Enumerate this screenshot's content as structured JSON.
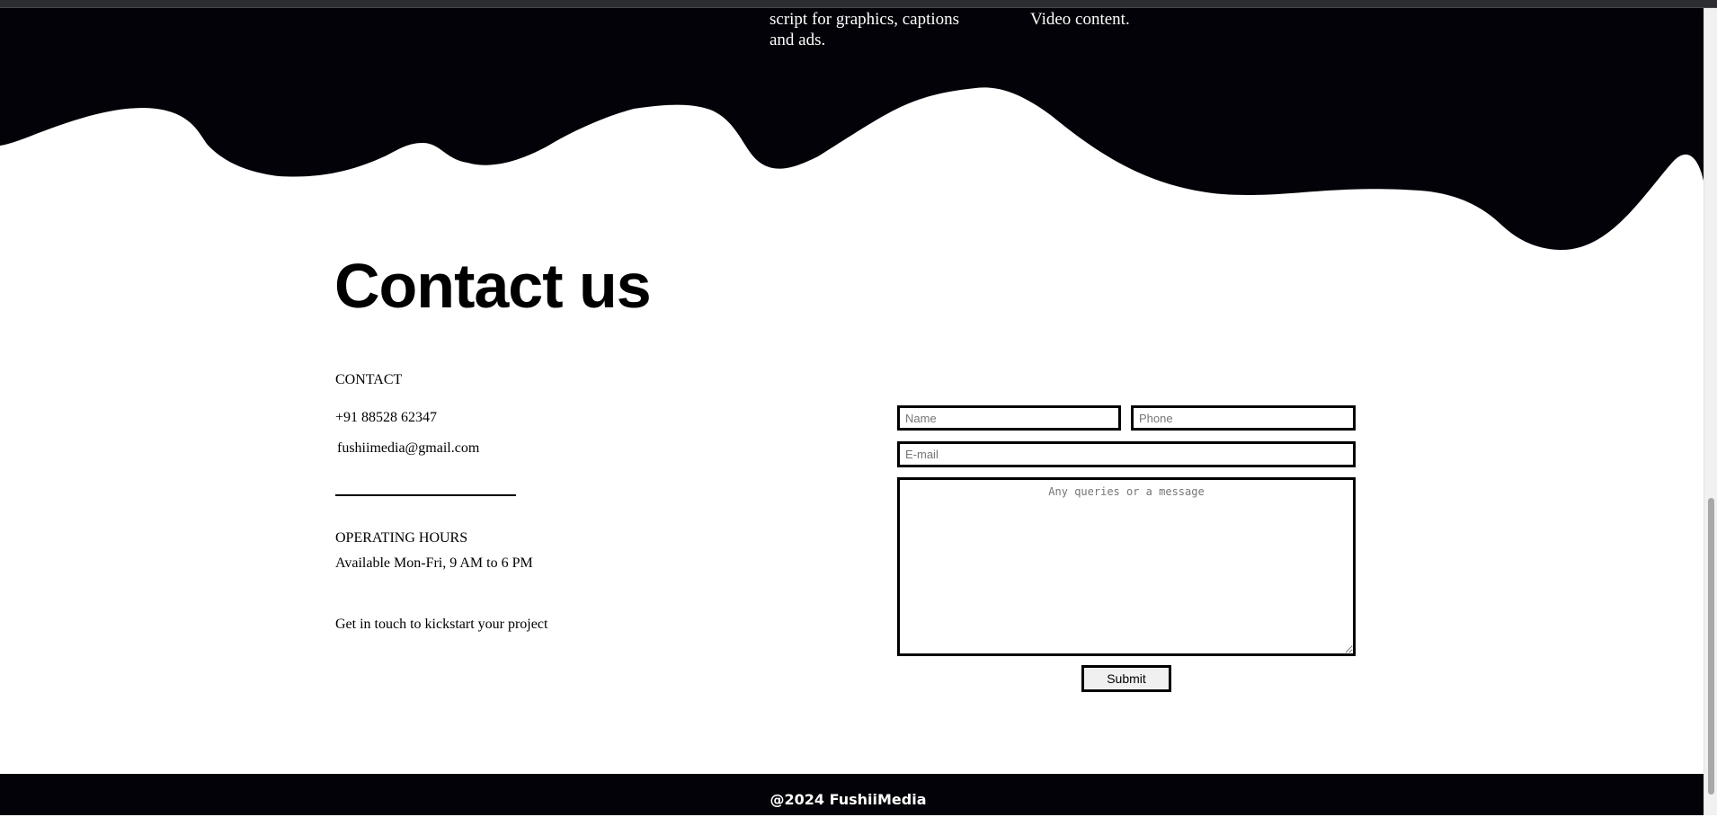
{
  "hero": {
    "text_left": "script for graphics, captions and ads.",
    "text_right": "Video content."
  },
  "contact": {
    "title": "Contact us",
    "section_label": "CONTACT",
    "phone": "+91 88528 62347",
    "email": "fushiimedia@gmail.com",
    "hours_label": "OPERATING HOURS",
    "hours": "Available Mon-Fri, 9 AM to 6 PM",
    "tagline": "Get in touch to kickstart your project"
  },
  "form": {
    "name_placeholder": "Name",
    "phone_placeholder": "Phone",
    "email_placeholder": "E-mail",
    "message_placeholder": "Any queries or a message",
    "submit_label": "Submit"
  },
  "footer": {
    "copyright": "@2024 FushiiMedia"
  },
  "colors": {
    "hero_background": "#020208",
    "page_background": "#ffffff",
    "text": "#000000",
    "footer_background": "#020208",
    "footer_text": "#ffffff"
  }
}
